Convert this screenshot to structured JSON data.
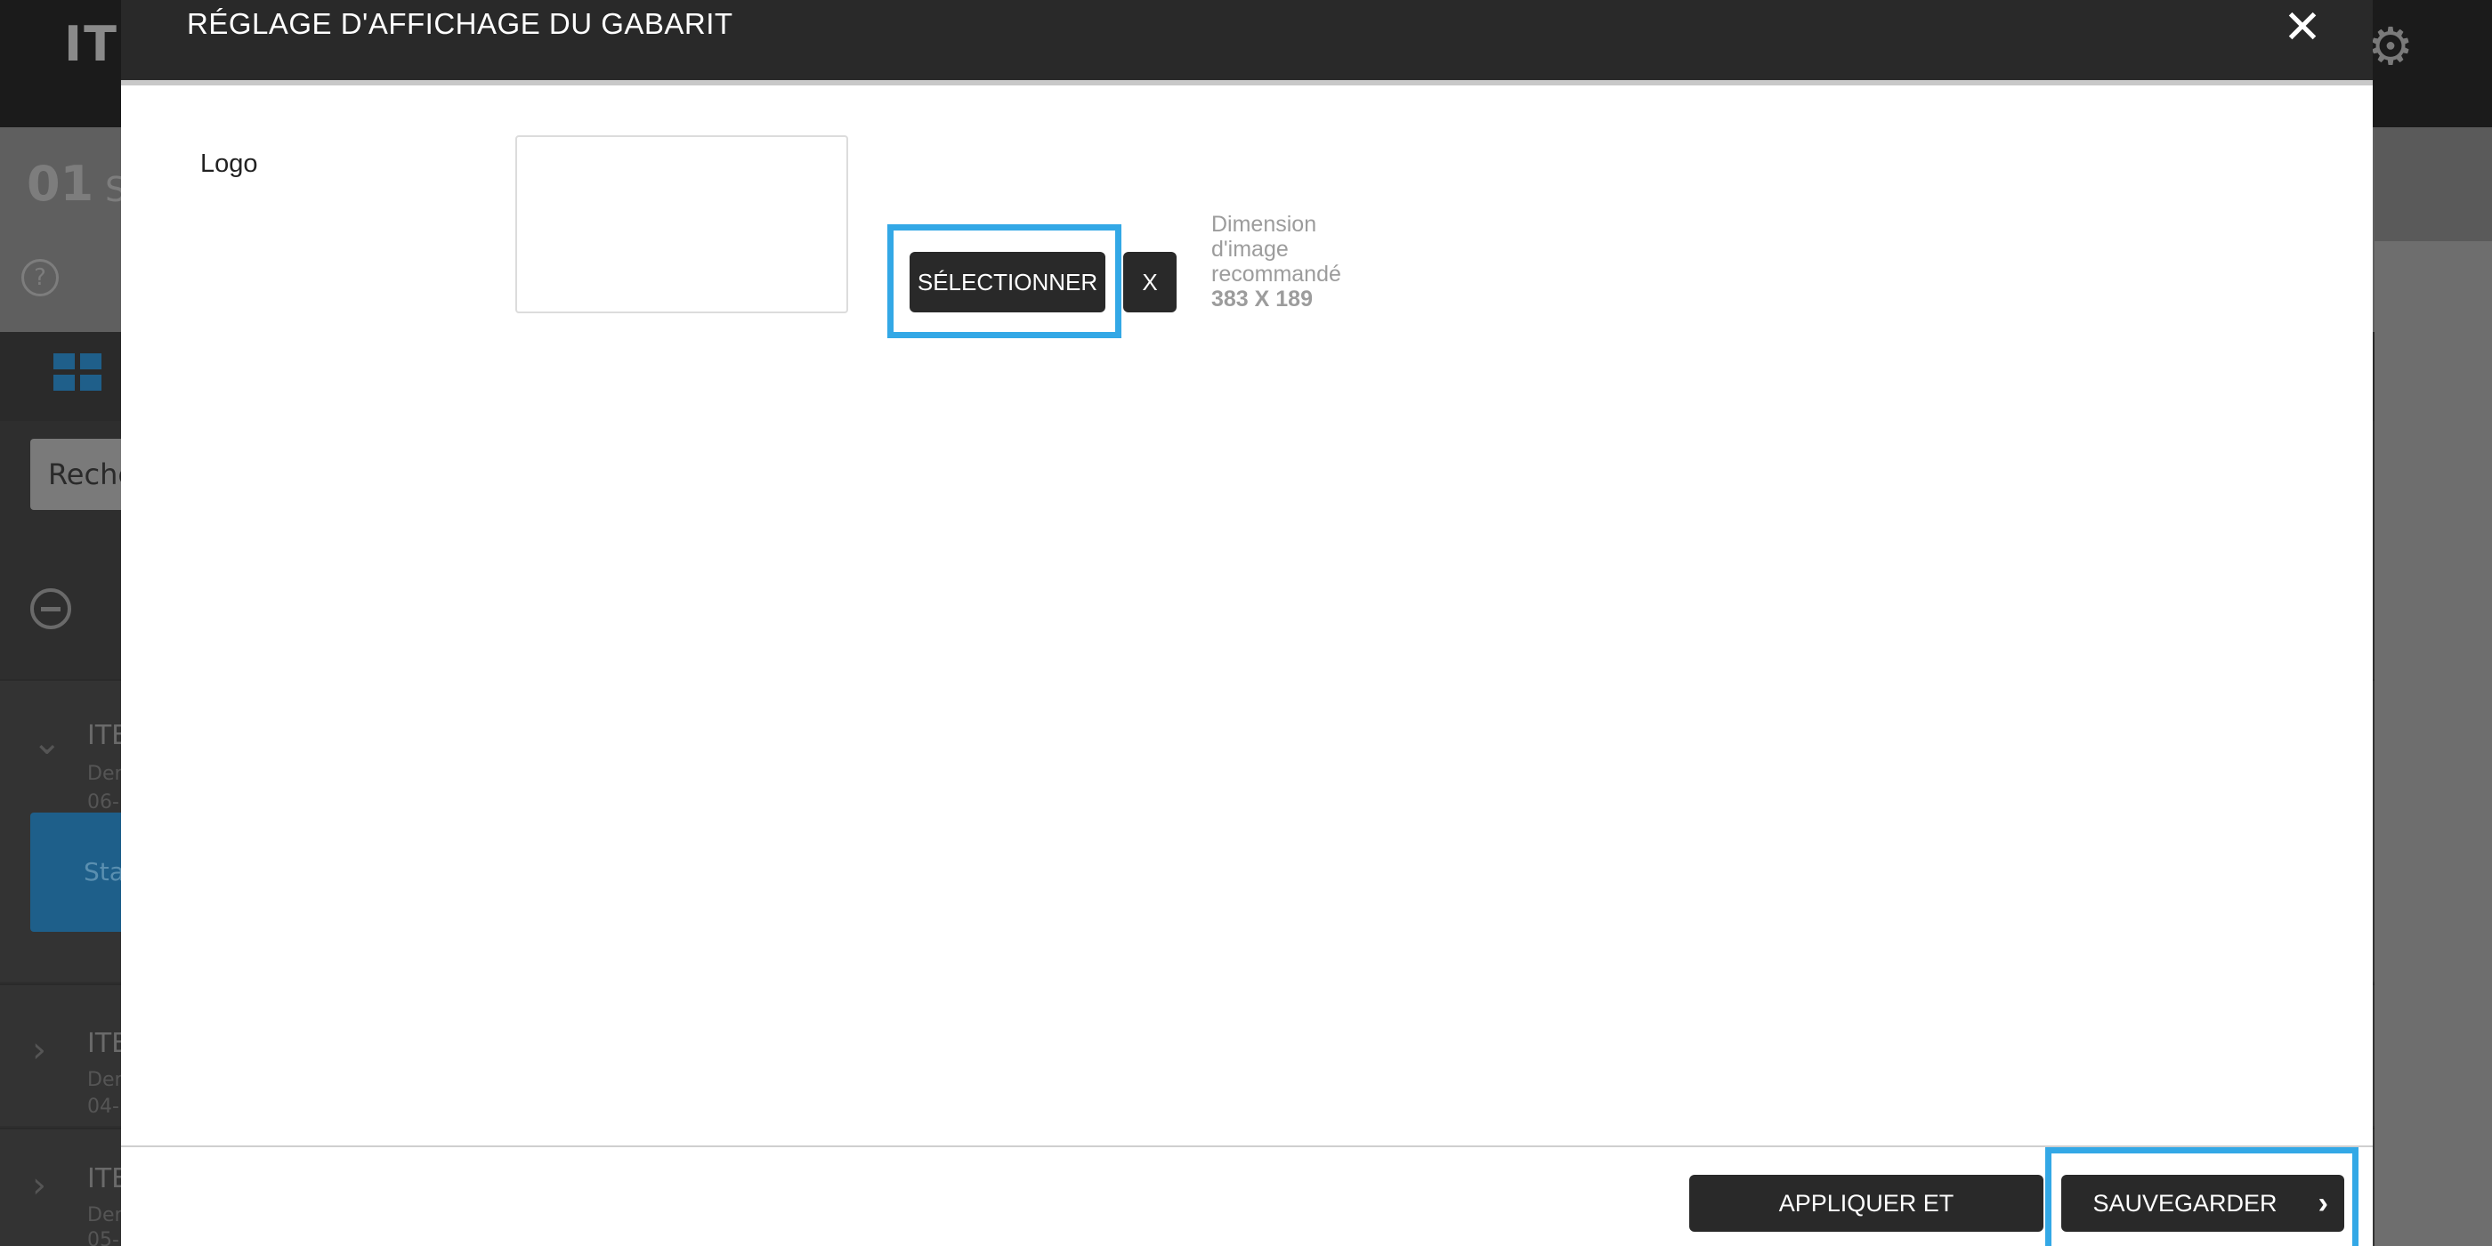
{
  "background": {
    "app_logo": "ITE",
    "step_number": "01",
    "step_subtitle": "S",
    "help_icon": "?",
    "search_placeholder": "Reche",
    "rows": [
      {
        "title": "ITE",
        "line1": "Der",
        "line2": "06-"
      },
      {
        "title": "ITE",
        "line1": "Der",
        "line2": "04-"
      },
      {
        "title": "ITE",
        "line1": "Der",
        "line2": "05-"
      }
    ],
    "status_label": "Sta"
  },
  "modal": {
    "title": "RÉGLAGE D'AFFICHAGE DU GABARIT",
    "close_icon": "close-icon",
    "close_glyph": "✕",
    "logo_label": "Logo",
    "select_button": "SÉLECTIONNER",
    "remove_button": "X",
    "dimension_hint_line1": "Dimension",
    "dimension_hint_line2": "d'image",
    "dimension_hint_line3": "recommandé",
    "dimension_hint_value": "383 X 189",
    "apply_button": "APPLIQUER ET PRÉVISUALISER",
    "save_button": "SAUVEGARDER",
    "save_chevron": "›"
  },
  "colors": {
    "highlight": "#33a8e6",
    "dark_button": "#292929",
    "header": "#292929"
  }
}
